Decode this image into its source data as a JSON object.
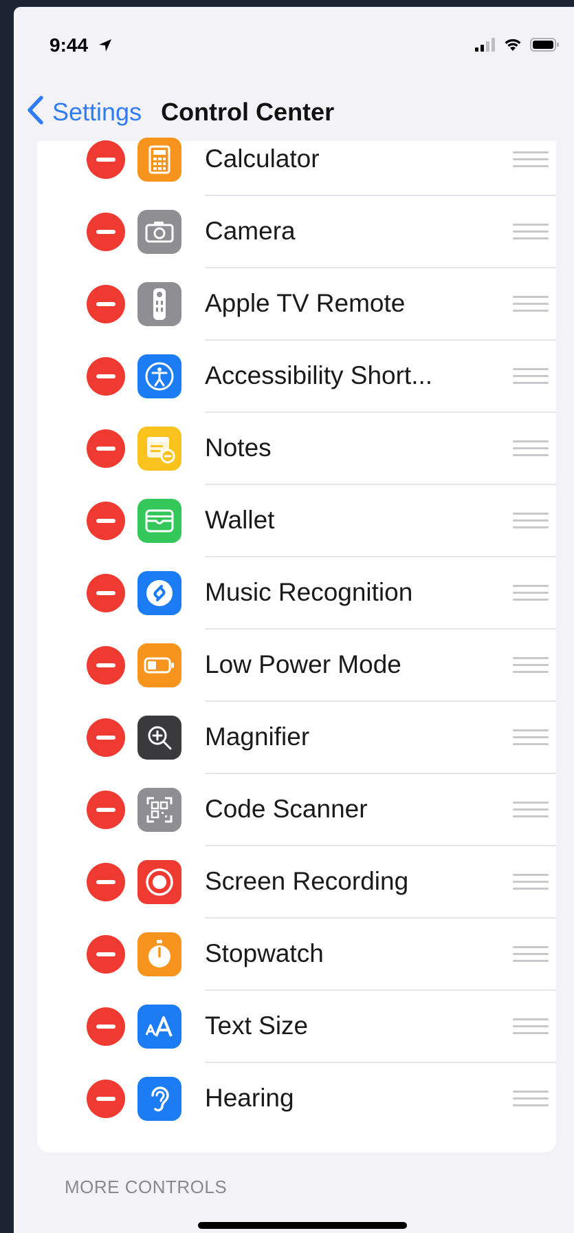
{
  "status_bar": {
    "time": "9:44"
  },
  "nav": {
    "back_label": "Settings",
    "title": "Control Center"
  },
  "colors": {
    "accent": "#2f7cf6",
    "remove": "#ef3a32",
    "background": "#f2f2f7"
  },
  "controls": [
    {
      "label": "Calculator",
      "icon": "calculator-icon",
      "color": "#f7941d"
    },
    {
      "label": "Camera",
      "icon": "camera-icon",
      "color": "#8e8e93"
    },
    {
      "label": "Apple TV Remote",
      "icon": "tv-remote-icon",
      "color": "#8e8e93"
    },
    {
      "label": "Accessibility Short...",
      "icon": "accessibility-icon",
      "color": "#1c7cf4"
    },
    {
      "label": "Notes",
      "icon": "notes-icon",
      "color": "#f9c21c"
    },
    {
      "label": "Wallet",
      "icon": "wallet-icon",
      "color": "#34c759"
    },
    {
      "label": "Music Recognition",
      "icon": "shazam-icon",
      "color": "#1c7cf4"
    },
    {
      "label": "Low Power Mode",
      "icon": "battery-icon",
      "color": "#f7941d"
    },
    {
      "label": "Magnifier",
      "icon": "magnifier-icon",
      "color": "#3a3a3c"
    },
    {
      "label": "Code Scanner",
      "icon": "qr-code-icon",
      "color": "#8e8e93"
    },
    {
      "label": "Screen Recording",
      "icon": "record-icon",
      "color": "#ef3a32"
    },
    {
      "label": "Stopwatch",
      "icon": "stopwatch-icon",
      "color": "#f7941d"
    },
    {
      "label": "Text Size",
      "icon": "text-size-icon",
      "color": "#1c7cf4"
    },
    {
      "label": "Hearing",
      "icon": "ear-icon",
      "color": "#1c7cf4"
    }
  ],
  "more_controls_header": "MORE CONTROLS"
}
